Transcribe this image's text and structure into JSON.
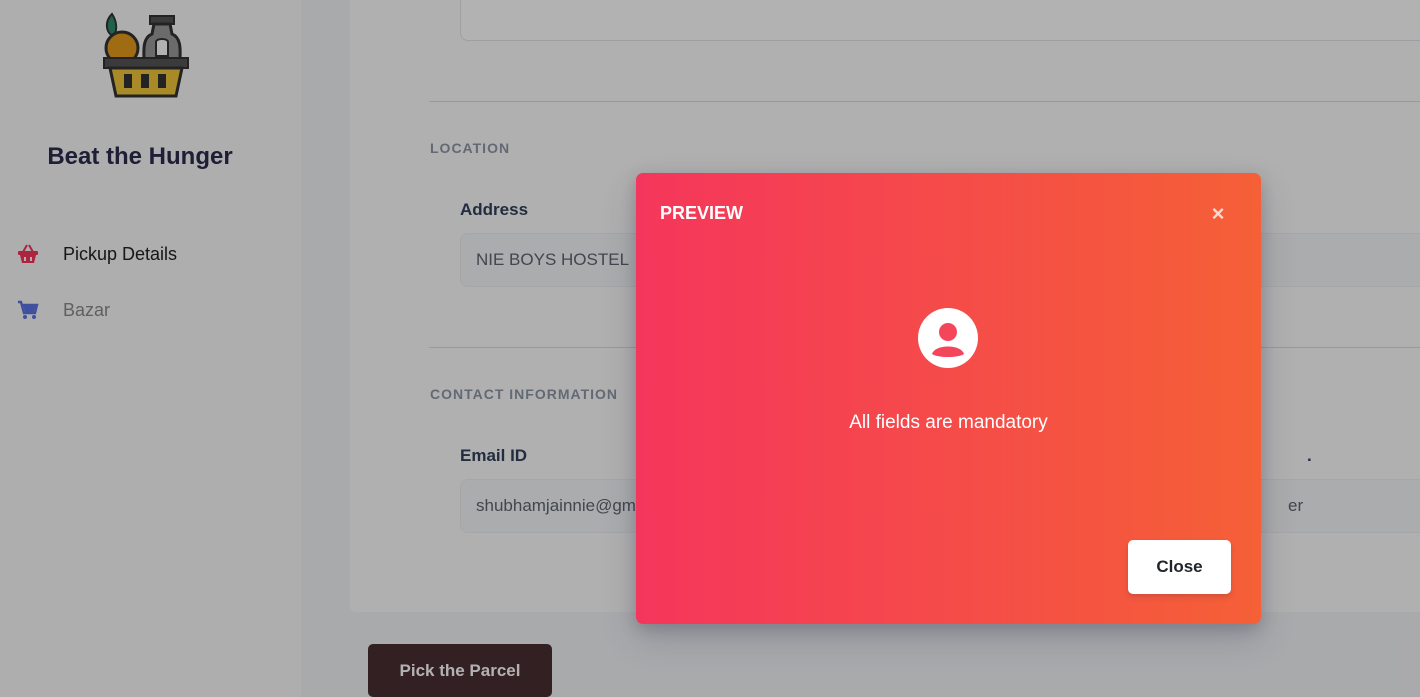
{
  "sidebar": {
    "brand": "Beat the Hunger",
    "items": [
      {
        "label": "Pickup Details",
        "icon": "basket-icon",
        "color": "#f5365c"
      },
      {
        "label": "Bazar",
        "icon": "cart-icon",
        "color": "#5e72e4"
      }
    ]
  },
  "form": {
    "location_title": "LOCATION",
    "address_label": "Address",
    "address_value": "NIE BOYS HOSTEL",
    "contact_title": "CONTACT INFORMATION",
    "email_label": "Email ID",
    "email_value": "shubhamjainnie@gmail.com",
    "phone_label_fragment": ".",
    "phone_value_fragment": "er",
    "submit_label": "Pick the Parcel"
  },
  "modal": {
    "title": "PREVIEW",
    "close_glyph": "×",
    "icon": "user-circle-icon",
    "message": "All fields are mandatory",
    "button_label": "Close",
    "gradient": [
      "#f5365c",
      "#f56036"
    ]
  }
}
